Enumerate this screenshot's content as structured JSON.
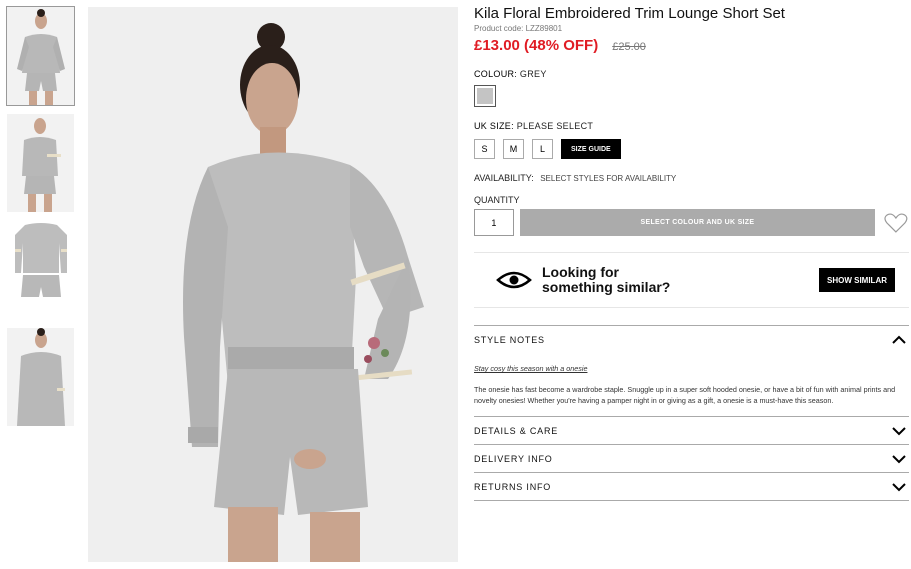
{
  "product": {
    "title": "Kila Floral Embroidered Trim Lounge Short Set",
    "code": "Product code: LZZ89801",
    "price": "£13.00 (48% OFF)",
    "was_price": "£25.00",
    "colour_label": "COLOUR:",
    "colour_value": "GREY",
    "size_label": "UK SIZE:",
    "size_value": "PLEASE SELECT",
    "sizes": [
      "S",
      "M",
      "L"
    ],
    "size_guide": "SIZE GUIDE",
    "availability_label": "AVAILABILITY:",
    "availability_value": "SELECT STYLES FOR AVAILABILITY",
    "quantity_label": "QUANTITY",
    "quantity_value": "1",
    "add_button": "SELECT COLOUR AND UK SIZE"
  },
  "similar": {
    "text_line1": "Looking for",
    "text_line2": "something similar?",
    "button": "SHOW SIMILAR"
  },
  "accordion": {
    "style_notes": "STYLE NOTES",
    "notes_tagline": "Stay cosy this season with a onesie",
    "notes_body": "The onesie has fast become a wardrobe staple. Snuggle up in a super soft hooded onesie, or have a bit of fun with animal prints and novelty onesies! Whether you're having a pamper night in or giving as a gift, a onesie is a must-have this season.",
    "details": "DETAILS & CARE",
    "delivery": "DELIVERY INFO",
    "returns": "RETURNS INFO"
  },
  "colors": {
    "sale_red": "#e01c24",
    "button_grey": "#ababab",
    "swatch_grey": "#c4c4c4"
  }
}
